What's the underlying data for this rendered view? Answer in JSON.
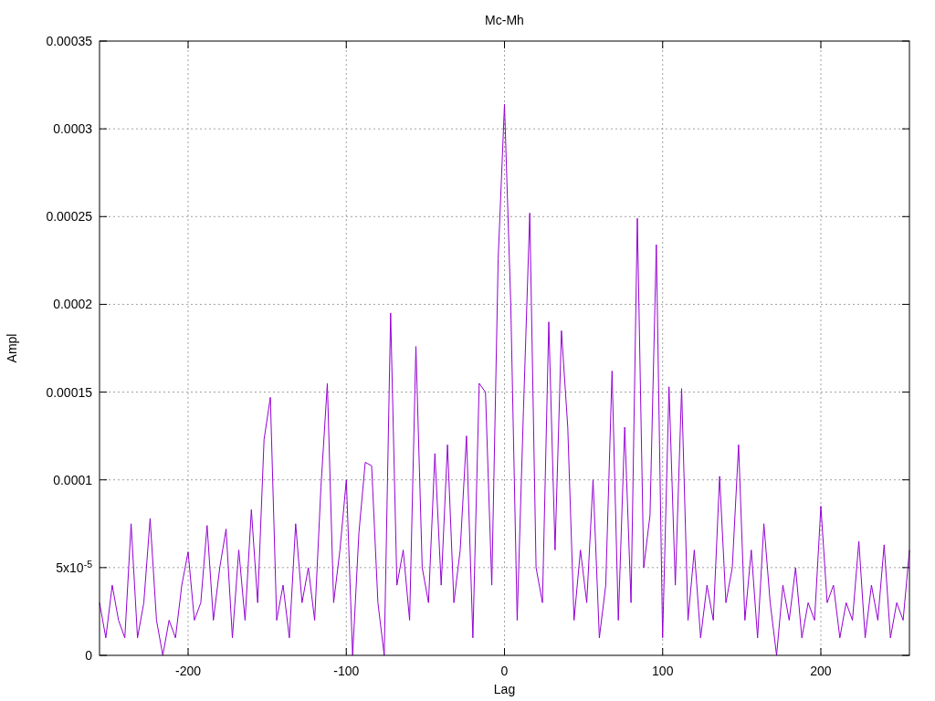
{
  "chart_data": {
    "type": "line",
    "title": "Mc-Mh",
    "xlabel": "Lag",
    "ylabel": "Ampl",
    "grid": true,
    "x": [
      -256,
      -252,
      -248,
      -244,
      -240,
      -236,
      -232,
      -228,
      -224,
      -220,
      -216,
      -212,
      -208,
      -204,
      -200,
      -196,
      -192,
      -188,
      -184,
      -180,
      -176,
      -172,
      -168,
      -164,
      -160,
      -156,
      -152,
      -148,
      -144,
      -140,
      -136,
      -132,
      -128,
      -124,
      -120,
      -116,
      -112,
      -108,
      -104,
      -100,
      -96,
      -92,
      -88,
      -84,
      -80,
      -76,
      -72,
      -68,
      -64,
      -60,
      -56,
      -52,
      -48,
      -44,
      -40,
      -36,
      -32,
      -28,
      -24,
      -20,
      -16,
      -12,
      -8,
      -4,
      0,
      4,
      8,
      12,
      16,
      20,
      24,
      28,
      32,
      36,
      40,
      44,
      48,
      52,
      56,
      60,
      64,
      68,
      72,
      76,
      80,
      84,
      88,
      92,
      96,
      100,
      104,
      108,
      112,
      116,
      120,
      124,
      128,
      132,
      136,
      140,
      144,
      148,
      152,
      156,
      160,
      164,
      168,
      172,
      176,
      180,
      184,
      188,
      192,
      196,
      200,
      204,
      208,
      212,
      216,
      220,
      224,
      228,
      232,
      236,
      240,
      244,
      248,
      252,
      256
    ],
    "xlim": [
      -256,
      256
    ],
    "ylim": [
      0,
      0.00035
    ],
    "xticks": [
      -200,
      -100,
      0,
      100,
      200
    ],
    "yticks": [
      0,
      {
        "value": 5e-05,
        "label": "5x10$^{-5}$"
      },
      {
        "value": 0.0001,
        "label": "0.0001"
      },
      {
        "value": 0.00015,
        "label": "0.00015"
      },
      {
        "value": 0.0002,
        "label": "0.0002"
      },
      {
        "value": 0.00025,
        "label": "0.00025"
      },
      {
        "value": 0.0003,
        "label": "0.0003"
      },
      {
        "value": 0.00035,
        "label": "0.00035"
      }
    ],
    "series": [
      {
        "color": "#9400d3",
        "values": [
          3e-05,
          1e-05,
          4e-05,
          2e-05,
          1e-05,
          7.5e-05,
          1e-05,
          3e-05,
          7.8e-05,
          2e-05,
          0,
          2e-05,
          1e-05,
          4e-05,
          5.9e-05,
          2e-05,
          3e-05,
          7.4e-05,
          2e-05,
          5e-05,
          7.2e-05,
          1e-05,
          6e-05,
          2e-05,
          8.3e-05,
          3e-05,
          0.000123,
          0.000147,
          2e-05,
          4e-05,
          1e-05,
          7.5e-05,
          3e-05,
          5e-05,
          2e-05,
          9.6e-05,
          0.000155,
          3e-05,
          6e-05,
          0.0001,
          0,
          7e-05,
          0.00011,
          0.000108,
          3e-05,
          0,
          0.000195,
          4e-05,
          6e-05,
          2e-05,
          0.000176,
          5e-05,
          3e-05,
          0.000115,
          4e-05,
          0.00012,
          3e-05,
          6e-05,
          0.000125,
          1e-05,
          0.000155,
          0.00015,
          4e-05,
          0.000226,
          0.000314,
          0.0002,
          2e-05,
          0.00014,
          0.000252,
          5e-05,
          3e-05,
          0.00019,
          6e-05,
          0.000185,
          0.00013,
          2e-05,
          6e-05,
          3e-05,
          0.0001,
          1e-05,
          4e-05,
          0.000162,
          2e-05,
          0.00013,
          3e-05,
          0.000249,
          5e-05,
          8e-05,
          0.000234,
          1e-05,
          0.000153,
          4e-05,
          0.000152,
          2e-05,
          6e-05,
          1e-05,
          4e-05,
          2e-05,
          0.000102,
          3e-05,
          5e-05,
          0.00012,
          2e-05,
          6e-05,
          1e-05,
          7.5e-05,
          3e-05,
          0,
          4e-05,
          2e-05,
          5e-05,
          1e-05,
          3e-05,
          2e-05,
          8.5e-05,
          3e-05,
          4e-05,
          1e-05,
          3e-05,
          2e-05,
          6.5e-05,
          1e-05,
          4e-05,
          2e-05,
          6.3e-05,
          1e-05,
          3e-05,
          2e-05,
          6e-05
        ]
      }
    ]
  }
}
